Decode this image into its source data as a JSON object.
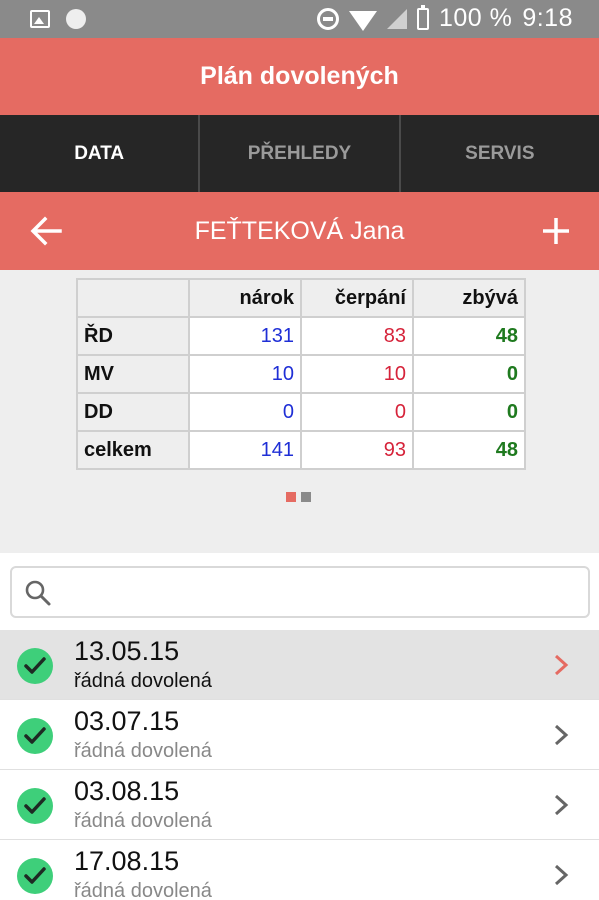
{
  "status_bar": {
    "battery": "100 %",
    "time": "9:18",
    "icons": [
      "image-icon",
      "circle-icon",
      "dnd-icon",
      "wifi-icon",
      "no-signal-icon",
      "battery-charging-icon"
    ]
  },
  "app_bar": {
    "title": "Plán dovolených"
  },
  "tabs": [
    {
      "label": "DATA",
      "active": true
    },
    {
      "label": "PŘEHLEDY",
      "active": false
    },
    {
      "label": "SERVIS",
      "active": false
    }
  ],
  "person": {
    "name": "FEŤTEKOVÁ Jana",
    "back_icon": "arrow-left-icon",
    "add_icon": "plus-icon"
  },
  "summary": {
    "columns": [
      "nárok",
      "čerpání",
      "zbývá"
    ],
    "rows": [
      {
        "label": "ŘD",
        "values": [
          "131",
          "83",
          "48"
        ]
      },
      {
        "label": "MV",
        "values": [
          "10",
          "10",
          "0"
        ]
      },
      {
        "label": "DD",
        "values": [
          "0",
          "0",
          "0"
        ]
      },
      {
        "label": "celkem",
        "values": [
          "141",
          "93",
          "48"
        ]
      }
    ],
    "colors": {
      "narok": "#1f2fd6",
      "cerpani": "#d6233a",
      "zbyva": "#1f7a1f"
    },
    "page_indicator": {
      "pages": 2,
      "current": 1
    }
  },
  "search": {
    "placeholder": "",
    "value": "",
    "icon": "search-icon"
  },
  "list": [
    {
      "date": "13.05.15",
      "type": "řádná dovolená",
      "selected": true
    },
    {
      "date": "03.07.15",
      "type": "řádná dovolená",
      "selected": false
    },
    {
      "date": "03.08.15",
      "type": "řádná dovolená",
      "selected": false
    },
    {
      "date": "17.08.15",
      "type": "řádná dovolená",
      "selected": false
    }
  ],
  "accent": "#e56b62",
  "check_color": "#3ecf7a"
}
